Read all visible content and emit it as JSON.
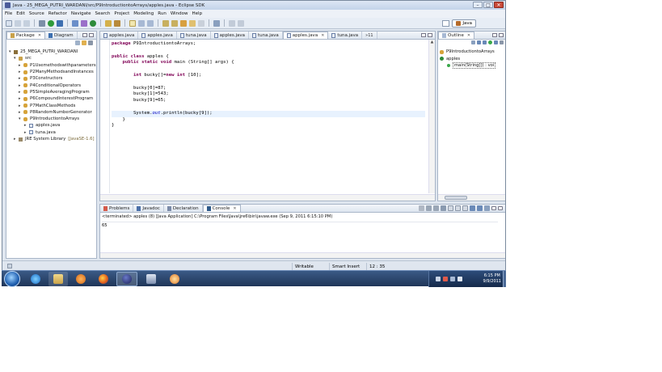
{
  "window": {
    "title": "Java - 25_MEGA_PUTRI_WARDANI/src/P9IntroductiontoArrays/apples.java - Eclipse SDK",
    "controls": [
      "–",
      "□",
      "✕"
    ]
  },
  "menu": [
    "File",
    "Edit",
    "Source",
    "Refactor",
    "Navigate",
    "Search",
    "Project",
    "Modeling",
    "Run",
    "Window",
    "Help"
  ],
  "perspective": {
    "active": "Java"
  },
  "left_panel": {
    "tabs": [
      {
        "label": "Package",
        "active": true
      },
      {
        "label": "Diagram",
        "active": false
      }
    ],
    "tree": {
      "project": "25_MEGA_PUTRI_WARDANI",
      "src": "src",
      "packages": [
        "P1Usemethodswithparameters",
        "P2ManyMethodsandInstances",
        "P3Constructors",
        "P4ConditionalOperators",
        "P5SimpleAveragingProgram",
        "P6CompoundInterestProgram",
        "P7MathClassMethods",
        "P8RandomNumberGenerator",
        "P9IntroductiontoArrays"
      ],
      "files": [
        "apples.java",
        "tuna.java"
      ],
      "library": "JRE System Library",
      "library_version": "[JavaSE-1.6]"
    }
  },
  "editor": {
    "tabs": [
      {
        "label": "apples.java",
        "active": false
      },
      {
        "label": "apples.java",
        "active": false
      },
      {
        "label": "tuna.java",
        "active": false
      },
      {
        "label": "apples.java",
        "active": false
      },
      {
        "label": "tuna.java",
        "active": false
      },
      {
        "label": "apples.java",
        "active": true
      },
      {
        "label": "tuna.java",
        "active": false
      }
    ],
    "tab_overflow": "»11",
    "code": [
      {
        "t": "package P9IntroductiontoArrays;",
        "hl": false
      },
      {
        "t": "",
        "hl": false
      },
      {
        "t": "public class apples {",
        "hl": false
      },
      {
        "t": "    public static void main (String[] args) {",
        "hl": false
      },
      {
        "t": "",
        "hl": false
      },
      {
        "t": "        int bucky[]=new int [10];",
        "hl": false
      },
      {
        "t": "",
        "hl": false
      },
      {
        "t": "        bucky[0]=87;",
        "hl": false
      },
      {
        "t": "        bucky[1]=543;",
        "hl": false
      },
      {
        "t": "        bucky[9]=65;",
        "hl": false
      },
      {
        "t": "",
        "hl": false
      },
      {
        "t": "        System.out.println(bucky[9]);",
        "hl": true
      },
      {
        "t": "    }",
        "hl": false
      },
      {
        "t": "}",
        "hl": false
      }
    ]
  },
  "outline": {
    "tab": "Outline",
    "package": "P9IntroductiontoArrays",
    "class": "apples",
    "method": "main(String[]) : voi"
  },
  "console": {
    "tabs": [
      {
        "label": "Problems",
        "active": false
      },
      {
        "label": "Javadoc",
        "active": false
      },
      {
        "label": "Declaration",
        "active": false
      },
      {
        "label": "Console",
        "active": true
      }
    ],
    "status": "<terminated> apples (8) [Java Application] C:\\Program Files\\Java\\jre6\\bin\\javaw.exe (Sep 9, 2011 6:15:10 PM)",
    "output": "65"
  },
  "statusbar": {
    "writable": "Writable",
    "insert_mode": "Smart Insert",
    "position": "12 : 35"
  },
  "taskbar": {
    "time": "6:15 PM",
    "date": "9/9/2011"
  },
  "colors": {
    "keyword": "#7f0055",
    "static_field": "#0000c0",
    "highlight_line": "#e8f2fe",
    "taskbar": "#1f3558"
  }
}
